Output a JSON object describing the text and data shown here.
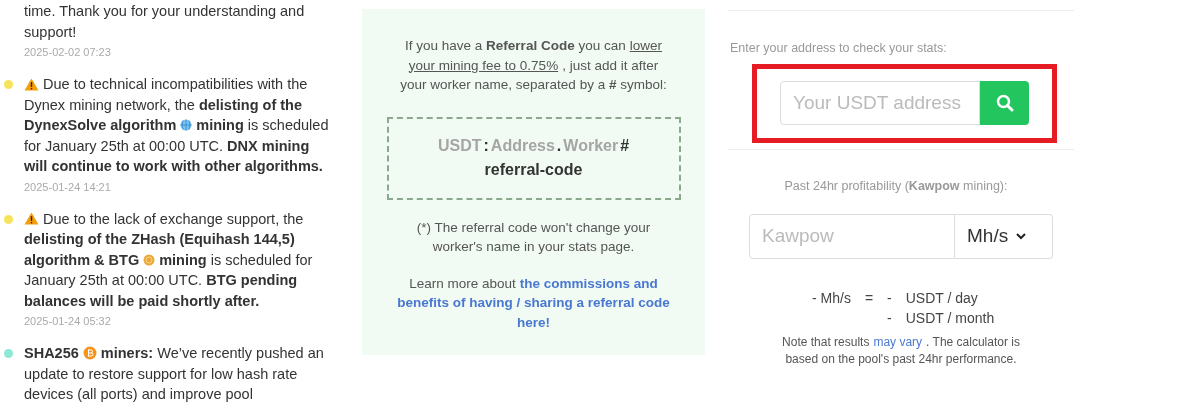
{
  "news": [
    {
      "lines": [
        [
          {
            "kind": "text",
            "text": "time. Thank you for your understanding and"
          }
        ],
        [
          {
            "kind": "text",
            "text": "support!"
          }
        ]
      ],
      "date": "2025-02-02 07:23"
    },
    {
      "color": "#f7e35a",
      "lines": [
        [
          {
            "kind": "warning"
          },
          {
            "kind": "text",
            "text": "Due to technical incompatibilities with the"
          }
        ],
        [
          {
            "kind": "text",
            "text": "Dynex mining network, the **delisting of the**"
          }
        ],
        [
          {
            "kind": "text",
            "text": "**DynexSolve algorithm**"
          },
          {
            "kind": "globe"
          },
          {
            "kind": "text",
            "text": "**mining** is scheduled"
          }
        ],
        [
          {
            "kind": "text",
            "text": "for January 25th at 00:00 UTC. **DNX mining**"
          }
        ],
        [
          {
            "kind": "text",
            "text": "**will continue to work with other algorithms.**"
          }
        ]
      ],
      "date": "2025-01-24 14:21"
    },
    {
      "color": "#f7e35a",
      "lines": [
        [
          {
            "kind": "warning"
          },
          {
            "kind": "text",
            "text": "Due to the lack of exchange support, the"
          }
        ],
        [
          {
            "kind": "text",
            "text": "**delisting of the ZHash (Equihash 144,5)**"
          }
        ],
        [
          {
            "kind": "text",
            "text": "**algorithm & BTG**"
          },
          {
            "kind": "coin"
          },
          {
            "kind": "text",
            "text": "**mining** is scheduled for"
          }
        ],
        [
          {
            "kind": "text",
            "text": "January 25th at 00:00 UTC. **BTG pending**"
          }
        ],
        [
          {
            "kind": "text",
            "text": "**balances will be paid shortly after.**"
          }
        ]
      ],
      "date": "2025-01-24 05:32"
    },
    {
      "color": "#8de8d5",
      "lines": [
        [
          {
            "kind": "text",
            "text": "**SHA256**"
          },
          {
            "kind": "bitcoin"
          },
          {
            "kind": "text",
            "text": "**miners:** We’ve recently pushed an"
          }
        ],
        [
          {
            "kind": "text",
            "text": "update to restore support for low hash rate"
          }
        ],
        [
          {
            "kind": "text",
            "text": "devices (all ports) and improve pool"
          }
        ]
      ]
    }
  ],
  "referral": {
    "intro": [
      [
        {
          "kind": "text",
          "text": "If you have a **Referral Code** you can"
        },
        {
          "kind": "link",
          "text": "lower"
        }
      ],
      [
        {
          "kind": "link",
          "text": "your mining fee to 0.75%"
        },
        {
          "kind": "text",
          "text": ", just add it after"
        }
      ],
      [
        {
          "kind": "text",
          "text": "your worker name, separated by a **#** symbol:"
        }
      ]
    ],
    "format": [
      [
        {
          "text": "USDT",
          "kind": "muted"
        },
        {
          "text": ":",
          "kind": "dark"
        },
        {
          "text": "Address",
          "kind": "muted"
        },
        {
          "text": ".",
          "kind": "dark"
        },
        {
          "text": "Worker",
          "kind": "muted"
        },
        {
          "text": "#",
          "kind": "dark"
        }
      ],
      [
        {
          "text": "referral-code",
          "kind": "dark"
        }
      ]
    ],
    "note": "(*) The referral code won't change your worker's name in your stats page.",
    "learn": [
      [
        {
          "kind": "text",
          "text": "Learn more about"
        },
        {
          "kind": "link",
          "text": "the commissions and"
        }
      ],
      [
        {
          "kind": "link",
          "text": "benefits of having / sharing a referral code"
        }
      ],
      [
        {
          "kind": "link",
          "text": "here!"
        }
      ]
    ]
  },
  "stats": {
    "label": "Enter your address to check your stats:",
    "placeholder": "Your USDT address",
    "highlighted": true
  },
  "calculator": {
    "label": "Past 24hr profitability (**Kawpow** mining):",
    "placeholder": "Kawpow",
    "unit": "Mh/s",
    "result_rate": "- Mh/s",
    "equals": "=",
    "rows": [
      {
        "value": "-",
        "unit": "USDT / day"
      },
      {
        "value": "-",
        "unit": "USDT / month"
      }
    ],
    "note": [
      [
        {
          "kind": "text",
          "text": "Note that results"
        },
        {
          "kind": "link",
          "text": "may vary"
        },
        {
          "kind": "text",
          "text": ". The calculator is"
        }
      ],
      [
        {
          "kind": "text",
          "text": "based on the pool's past 24hr performance."
        }
      ]
    ]
  }
}
